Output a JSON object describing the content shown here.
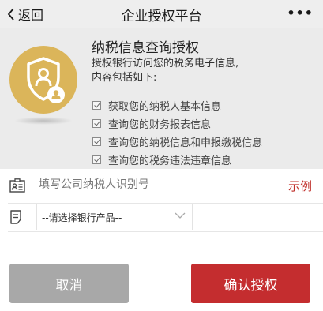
{
  "nav": {
    "back_label": "返回",
    "title": "企业授权平台",
    "more_label": "•••"
  },
  "hero": {
    "heading": "纳税信息查询授权",
    "desc_line1": "授权银行访问您的税务电子信息,",
    "desc_line2": "内容包括如下:",
    "items": [
      {
        "label": "获取您的纳税人基本信息",
        "checked": true
      },
      {
        "label": "查询您的财务报表信息",
        "checked": true
      },
      {
        "label": "查询您的纳税信息和申报缴税信息",
        "checked": true
      },
      {
        "label": "查询您的税务违法违章信息",
        "checked": true
      }
    ]
  },
  "form": {
    "taxpayer_id": {
      "value": "",
      "placeholder": "填写公司纳税人识别号"
    },
    "example_label": "示例",
    "product_select": {
      "selected": "--请选择银行产品--"
    }
  },
  "actions": {
    "cancel_label": "取消",
    "confirm_label": "确认授权"
  },
  "colors": {
    "accent": "#c42d2f",
    "badge": "#dbb55a",
    "cancel": "#a8a8a8"
  },
  "icons": {
    "back": "chevron-left-icon",
    "badge": "shield-user-icon",
    "id_card": "id-card-icon",
    "document": "document-icon",
    "dropdown": "chevron-down-icon"
  }
}
